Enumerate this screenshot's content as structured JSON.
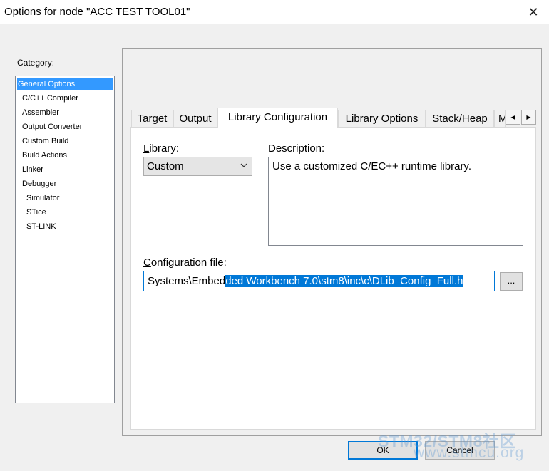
{
  "window": {
    "title": "Options for node \"ACC TEST TOOL01\"",
    "close_glyph": "✕"
  },
  "category": {
    "label": "Category:",
    "items": [
      {
        "label": "General Options",
        "selected": true,
        "indent": 0
      },
      {
        "label": "C/C++ Compiler",
        "selected": false,
        "indent": 1
      },
      {
        "label": "Assembler",
        "selected": false,
        "indent": 1
      },
      {
        "label": "Output Converter",
        "selected": false,
        "indent": 1
      },
      {
        "label": "Custom Build",
        "selected": false,
        "indent": 1
      },
      {
        "label": "Build Actions",
        "selected": false,
        "indent": 1
      },
      {
        "label": "Linker",
        "selected": false,
        "indent": 1
      },
      {
        "label": "Debugger",
        "selected": false,
        "indent": 1
      },
      {
        "label": "Simulator",
        "selected": false,
        "indent": 2
      },
      {
        "label": "STice",
        "selected": false,
        "indent": 2
      },
      {
        "label": "ST-LINK",
        "selected": false,
        "indent": 2
      }
    ]
  },
  "tabs": [
    {
      "label": "Target",
      "active": false
    },
    {
      "label": "Output",
      "active": false
    },
    {
      "label": "Library Configuration",
      "active": true
    },
    {
      "label": "Library Options",
      "active": false
    },
    {
      "label": "Stack/Heap",
      "active": false
    },
    {
      "label": "M",
      "active": false
    }
  ],
  "tab_scroll": {
    "left_glyph": "◀",
    "right_glyph": "▶"
  },
  "library": {
    "label_mnemonic": "L",
    "label_rest": "ibrary:",
    "value": "Custom"
  },
  "description": {
    "label": "Description:",
    "text": "Use a customized C/EC++ runtime library."
  },
  "config_file": {
    "label_mnemonic": "C",
    "label_rest": "onfiguration file:",
    "value_normal": "Systems\\Embed",
    "value_selected": "ded Workbench 7.0\\stm8\\inc\\c\\DLib_Config_Full.h",
    "browse_label": "..."
  },
  "buttons": {
    "ok": "OK",
    "cancel": "Cancel"
  },
  "watermark": {
    "line1": "STM32/STM8社区",
    "line2": "www.stmcu.org"
  },
  "colors": {
    "selection": "#3399ff",
    "focus": "#0078d7",
    "text_selection": "#0078d7"
  }
}
